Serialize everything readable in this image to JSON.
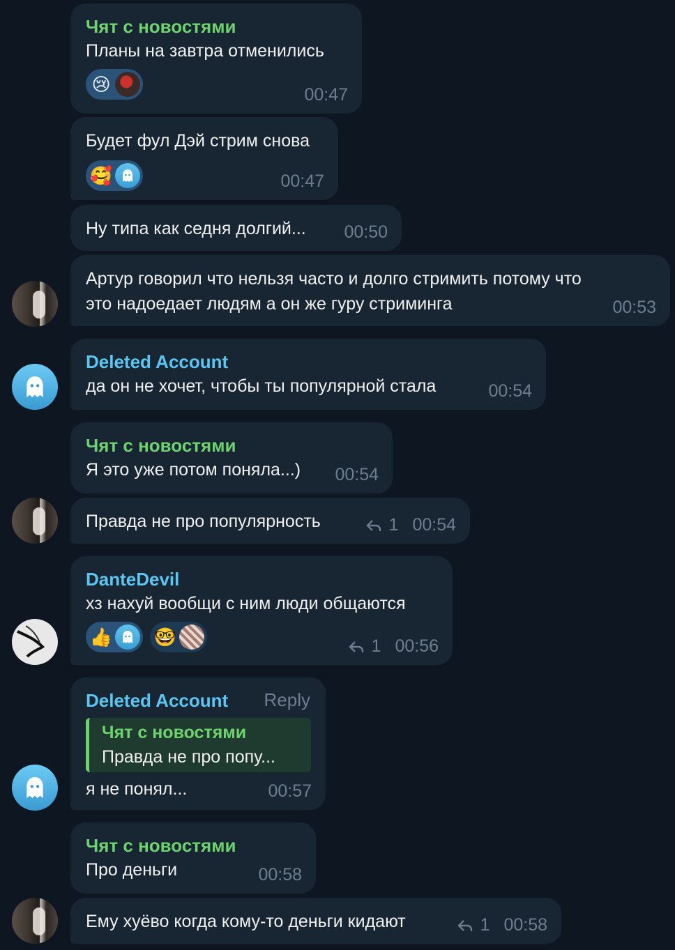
{
  "colors": {
    "background": "#0e1621",
    "bubble": "#182533",
    "green_name": "#6ed36e",
    "blue_name": "#5cc6f0",
    "meta": "#6c7e90"
  },
  "messages": [
    {
      "sender": "Чят с новостями",
      "text": "Планы на завтра отменились",
      "time": "00:47",
      "reactions": [
        "😢",
        "photo"
      ]
    },
    {
      "text": "Будет фул Дэй стрим снова",
      "time": "00:47",
      "reactions": [
        "🥰",
        "ghost"
      ]
    },
    {
      "text": "Ну типа как седня долгий...",
      "time": "00:50"
    },
    {
      "text_line1": "Артур говорил что нельзя часто и долго стримить потому что",
      "text_line2": "это надоедает людям а он же гуру стриминга",
      "time": "00:53"
    },
    {
      "sender": "Deleted Account",
      "text": "да он не хочет, чтобы ты популярной стала",
      "time": "00:54"
    },
    {
      "sender": "Чят с новостями",
      "text": "Я это уже потом поняла...)",
      "time": "00:54"
    },
    {
      "text": "Правда не про популярность",
      "replies": "1",
      "time": "00:54"
    },
    {
      "sender": "DanteDevil",
      "text": "хз нахуй вообщи с ним люди общаются",
      "replies": "1",
      "time": "00:56",
      "reactions": [
        "👍",
        "ghost",
        "🤓",
        "photo2"
      ]
    },
    {
      "sender": "Deleted Account",
      "reply_label": "Reply",
      "quote_name": "Чят с новостями",
      "quote_text": "Правда не про попу...",
      "text": "я не понял...",
      "time": "00:57"
    },
    {
      "sender": "Чят с новостями",
      "text": "Про деньги",
      "time": "00:58"
    },
    {
      "text": "Ему хуёво когда кому-то деньги кидают",
      "replies": "1",
      "time": "00:58"
    }
  ]
}
